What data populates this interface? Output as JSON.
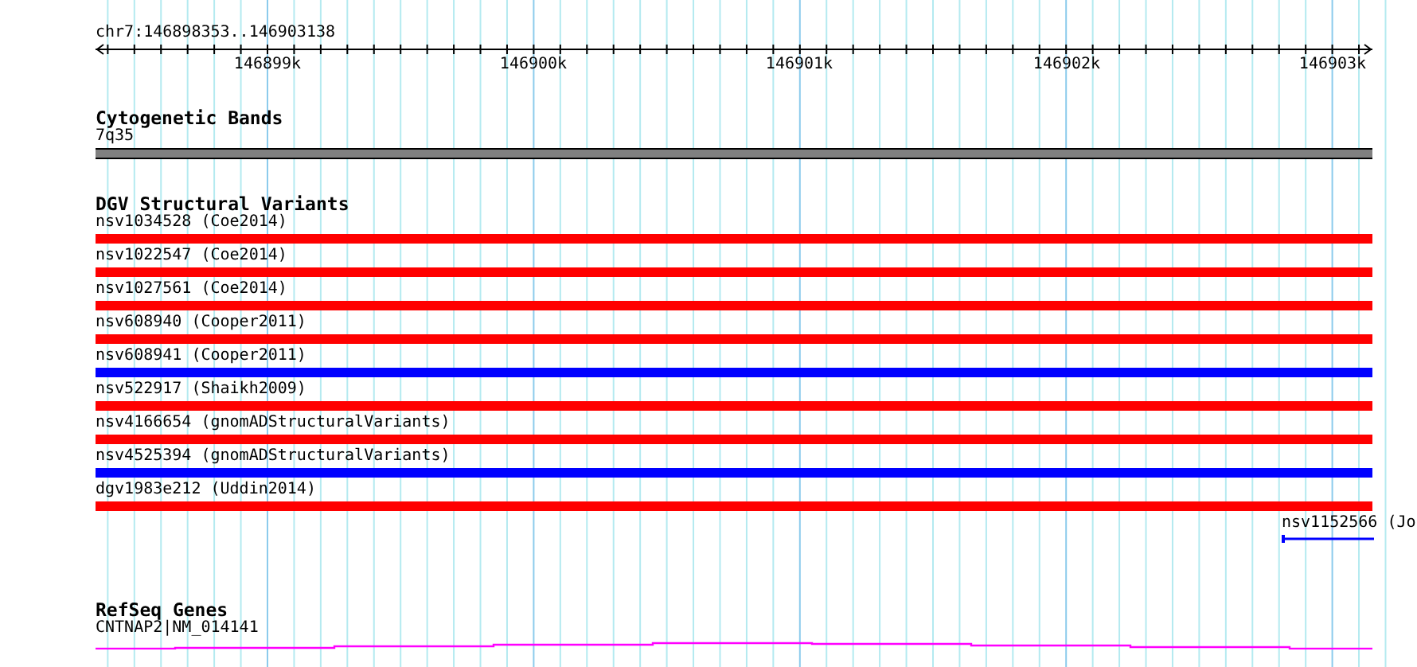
{
  "ruler": {
    "location": "chr7:146898353..146903138",
    "ticks": [
      "146899k",
      "146900k",
      "146901k",
      "146902k",
      "146903k"
    ]
  },
  "tracks": [
    {
      "title": "Cytogenetic Bands",
      "kind": "bands",
      "features": [
        {
          "label": "7q35",
          "kind": "bar",
          "color": "#808080"
        }
      ]
    },
    {
      "title": "DGV Structural Variants",
      "kind": "variants",
      "features": [
        {
          "label": "nsv1034528 (Coe2014)",
          "kind": "bar",
          "color": "#ff0000"
        },
        {
          "label": "nsv1022547 (Coe2014)",
          "kind": "bar",
          "color": "#ff0000"
        },
        {
          "label": "nsv1027561 (Coe2014)",
          "kind": "bar",
          "color": "#ff0000"
        },
        {
          "label": "nsv608940 (Cooper2011)",
          "kind": "bar",
          "color": "#ff0000"
        },
        {
          "label": "nsv608941 (Cooper2011)",
          "kind": "bar",
          "color": "#0000ff"
        },
        {
          "label": "nsv522917 (Shaikh2009)",
          "kind": "bar",
          "color": "#ff0000"
        },
        {
          "label": "nsv4166654 (gnomADStructuralVariants)",
          "kind": "bar",
          "color": "#ff0000"
        },
        {
          "label": "nsv4525394 (gnomADStructuralVariants)",
          "kind": "bar",
          "color": "#0000ff"
        },
        {
          "label": "dgv1983e212 (Uddin2014)",
          "kind": "bar",
          "color": "#ff0000"
        },
        {
          "label": "nsv1152566 (Jo",
          "kind": "line",
          "color": "#0000ff"
        }
      ]
    },
    {
      "title": "RefSeq Genes",
      "kind": "genes",
      "features": [
        {
          "label": "CNTNAP2|NM_014141",
          "kind": "gene",
          "color": "#ff00ff"
        }
      ]
    }
  ]
}
